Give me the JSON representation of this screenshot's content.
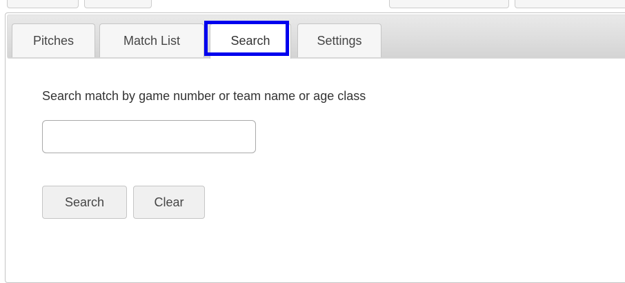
{
  "tabs": [
    {
      "label": "Pitches",
      "active": false
    },
    {
      "label": "Match List",
      "active": false
    },
    {
      "label": "Search",
      "active": true
    },
    {
      "label": "Settings",
      "active": false
    }
  ],
  "search": {
    "prompt": "Search match by game number or team name or age class",
    "input_value": "",
    "input_placeholder": "",
    "search_button_label": "Search",
    "clear_button_label": "Clear"
  },
  "colors": {
    "highlight": "#0000ee",
    "active_tab": "#ffffff",
    "inactive_tab": "#f6f6f6",
    "tab_bar": "#d4d4d4"
  }
}
